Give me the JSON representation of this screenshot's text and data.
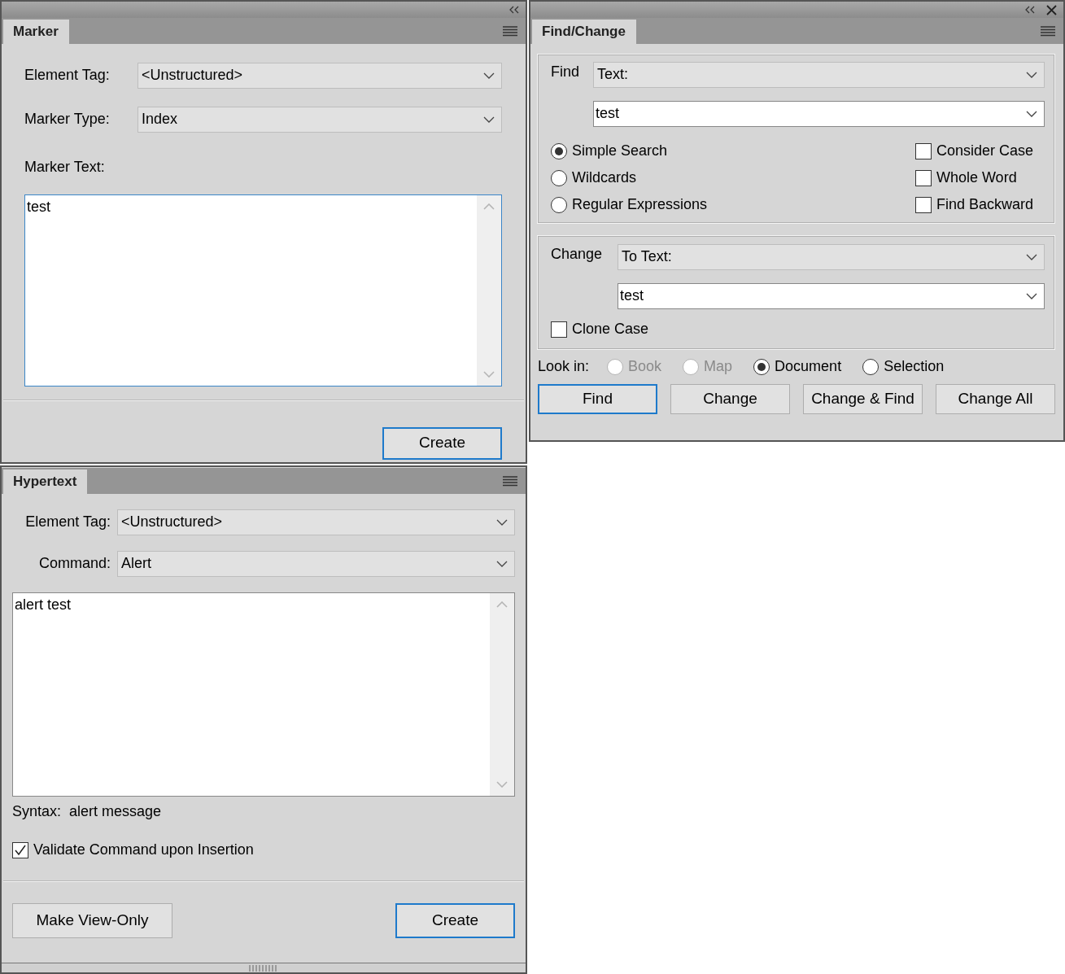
{
  "marker": {
    "tab": "Marker",
    "element_tag_label": "Element Tag:",
    "element_tag": "<Unstructured>",
    "marker_type_label": "Marker Type:",
    "marker_type": "Index",
    "marker_text_label": "Marker Text:",
    "marker_text": "test",
    "buttons": [
      {
        "label": "Create",
        "default": true
      }
    ]
  },
  "hypertext": {
    "tab": "Hypertext",
    "element_tag_label": "Element Tag:",
    "element_tag": "<Unstructured>",
    "command_label": "Command:",
    "command": "Alert",
    "text": "alert test",
    "syntax_label": "Syntax:",
    "syntax": "alert message",
    "validate": {
      "label": "Validate Command upon Insertion",
      "checked": true
    },
    "buttons": [
      {
        "label": "Make View-Only",
        "default": false
      },
      {
        "label": "Create",
        "default": true
      }
    ]
  },
  "find_change": {
    "tab": "Find/Change",
    "find_label": "Find",
    "find_type": "Text:",
    "find_value": "test",
    "modes": [
      {
        "label": "Simple Search",
        "selected": true
      },
      {
        "label": "Wildcards",
        "selected": false
      },
      {
        "label": "Regular Expressions",
        "selected": false
      }
    ],
    "options": [
      {
        "label": "Consider Case",
        "checked": false
      },
      {
        "label": "Whole Word",
        "checked": false
      },
      {
        "label": "Find Backward",
        "checked": false
      }
    ],
    "change_label": "Change",
    "change_type": "To Text:",
    "change_value": "test",
    "clone_case": {
      "label": "Clone Case",
      "checked": false
    },
    "look_in_label": "Look in:",
    "look_in": [
      {
        "label": "Book",
        "selected": false,
        "disabled": true
      },
      {
        "label": "Map",
        "selected": false,
        "disabled": true
      },
      {
        "label": "Document",
        "selected": true,
        "disabled": false
      },
      {
        "label": "Selection",
        "selected": false,
        "disabled": false
      }
    ],
    "buttons": [
      {
        "label": "Find",
        "default": true
      },
      {
        "label": "Change",
        "default": false
      },
      {
        "label": "Change & Find",
        "default": false
      },
      {
        "label": "Change All",
        "default": false
      }
    ]
  }
}
